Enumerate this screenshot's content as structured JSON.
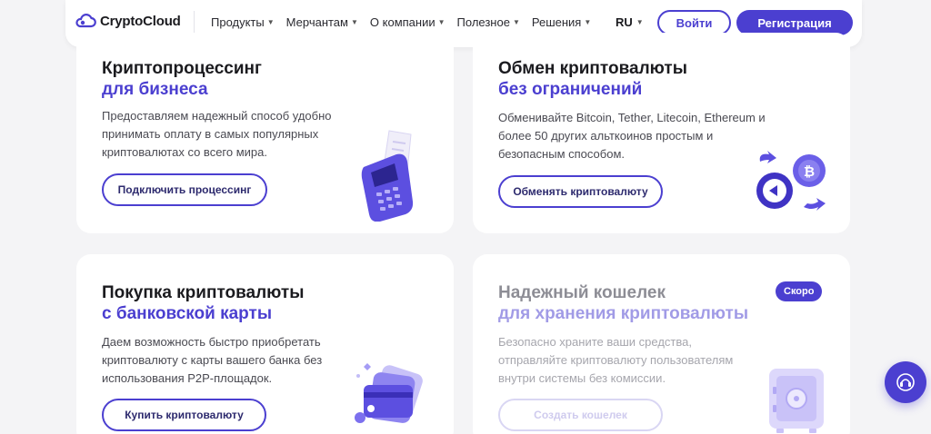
{
  "header": {
    "logo_text": "CryptoCloud",
    "nav": [
      "Продукты",
      "Мерчантам",
      "О компании",
      "Полезное",
      "Решения"
    ],
    "language": "RU",
    "login_label": "Войти",
    "register_label": "Регистрация"
  },
  "cards": [
    {
      "title": "Криптопроцессинг",
      "subtitle": "для бизнеса",
      "description": "Предоставляем надежный способ удобно принимать оплату в самых популярных криптовалютах со всего мира.",
      "button": "Подключить процессинг"
    },
    {
      "title": "Обмен криптовалюты",
      "subtitle": "без ограничений",
      "description": "Обменивайте Bitcoin, Tether, Litecoin, Ethereum и более 50 других альткоинов простым и безопасным способом.",
      "button": "Обменять криптовалюту"
    },
    {
      "title": "Покупка криптовалюты",
      "subtitle": "с банковской карты",
      "description": "Даем возможность быстро приобретать криптовалюту с карты вашего банка без использования P2P-площадок.",
      "button": "Купить криптовалюту"
    },
    {
      "title": "Надежный кошелек",
      "subtitle": "для хранения криптовалюты",
      "description": "Безопасно храните ваши средства, отправляйте криптовалюту пользователям внутри системы без комиссии.",
      "button": "Создать кошелек",
      "badge": "Скоро"
    }
  ],
  "colors": {
    "accent": "#4b3fd0",
    "background": "#f4f4f6"
  },
  "icons": [
    "cloud-logo-icon",
    "chevron-down-icon",
    "pos-terminal-icon",
    "crypto-exchange-icon",
    "bank-cards-icon",
    "safe-icon",
    "support-chat-icon"
  ]
}
